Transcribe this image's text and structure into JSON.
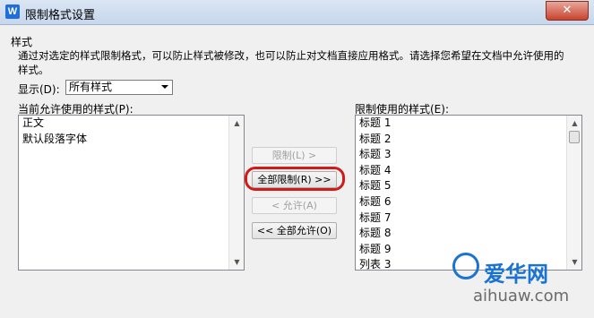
{
  "window": {
    "title": "限制格式设置",
    "close_glyph": "✕",
    "app_icon_letter": "W"
  },
  "group": {
    "label": "样式",
    "description_line1": "通过对选定的样式限制格式，可以防止样式被修改，也可以防止对文档直接应用格式。请选择您希望在文档中允许使用的",
    "description_line2": "样式。"
  },
  "display": {
    "label": "显示(D):",
    "value": "所有样式"
  },
  "allowed_list": {
    "label": "当前允许使用的样式(P):",
    "items": [
      "正文",
      "默认段落字体"
    ]
  },
  "restricted_list": {
    "label": "限制使用的样式(E):",
    "items": [
      "标题 1",
      "标题 2",
      "标题 3",
      "标题 4",
      "标题 5",
      "标题 6",
      "标题 7",
      "标题 8",
      "标题 9",
      "列表 3"
    ]
  },
  "buttons": {
    "restrict": "限制(L) >",
    "restrict_all": "全部限制(R) >>",
    "allow": "< 允许(A)",
    "allow_all": "<< 全部允许(O)"
  },
  "watermark": {
    "text": "爱华网",
    "url": "aihuaw.com"
  },
  "colors": {
    "highlight": "#d11a1a",
    "titlebar": "#c6d6ec",
    "close": "#c8432f"
  }
}
